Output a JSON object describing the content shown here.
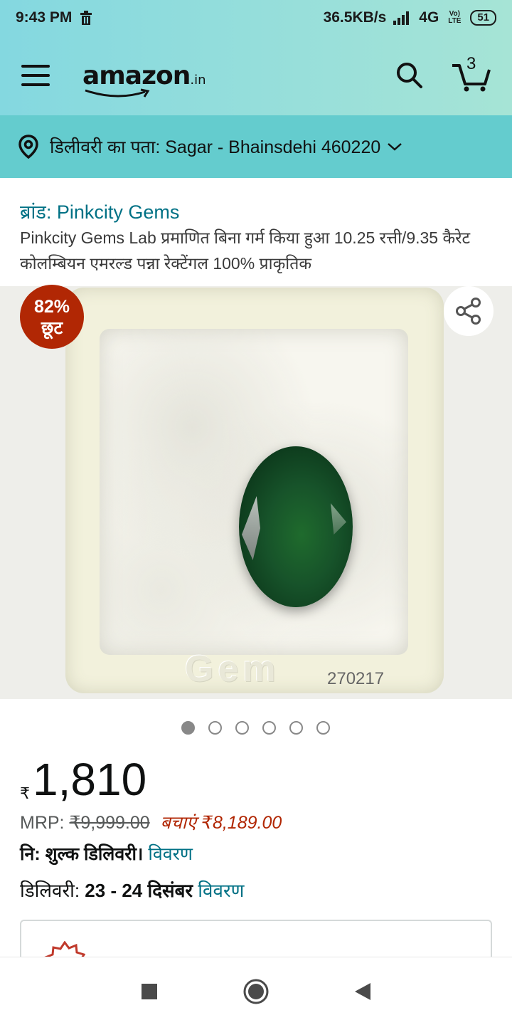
{
  "status_bar": {
    "time": "9:43 PM",
    "net_speed": "36.5KB/s",
    "network": "4G",
    "volte": "Vo) LTE",
    "battery": "51"
  },
  "header": {
    "logo_text": "amazon",
    "logo_tld": ".in",
    "cart_count": "3"
  },
  "location": {
    "label": "डिलीवरी का पता: Sagar - Bhainsdehi 460220"
  },
  "product": {
    "brand": "ब्रांड: Pinkcity Gems",
    "title": "Pinkcity Gems Lab प्रमाणित बिना गर्म किया हुआ 10.25 रत्ती/9.35 कैरेट कोलम्बियन एमरल्ड पन्ना रेक्टेंगल 100% प्राकृतिक",
    "discount_pct": "82%",
    "discount_word": "छूट",
    "box_serial": "270217",
    "box_emboss": "Gem",
    "image_count": 6,
    "active_image": 0
  },
  "pricing": {
    "currency": "₹",
    "price": "1,810",
    "mrp_label": "MRP:",
    "mrp_value": "₹9,999.00",
    "savings": "बचाएं ₹8,189.00",
    "free_delivery": "नि: शुल्क डिलिवरी।",
    "free_delivery_link": "विवरण",
    "delivery_label": "डिलिवरी:",
    "delivery_date": "23 - 24 दिसंबर",
    "delivery_link": "विवरण"
  },
  "colors": {
    "header_start": "#84d8e0",
    "header_end": "#a6e4d6",
    "location_bg": "#64ccce",
    "link": "#007185",
    "discount_bg": "#b12704"
  },
  "icons": {
    "menu": "hamburger-icon",
    "search": "search-icon",
    "cart": "cart-icon",
    "location": "location-pin-icon",
    "share": "share-icon",
    "nav_recent": "square-icon",
    "nav_home": "circle-icon",
    "nav_back": "triangle-back-icon"
  }
}
